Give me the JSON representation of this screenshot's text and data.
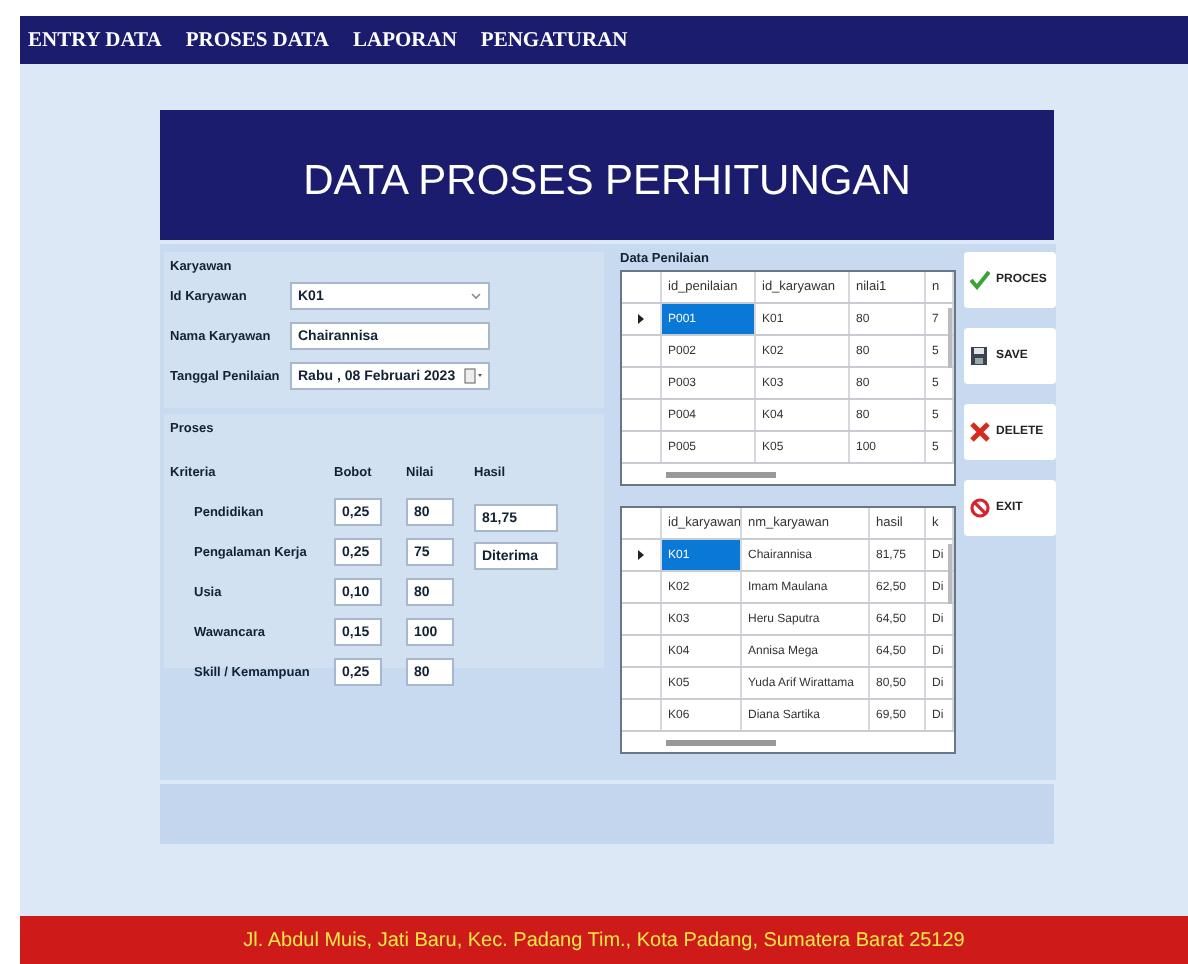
{
  "menu": [
    "ENTRY DATA",
    "PROSES DATA",
    "LAPORAN",
    "PENGATURAN"
  ],
  "title": "DATA PROSES PERHITUNGAN",
  "karyawan": {
    "title": "Karyawan",
    "fields": [
      {
        "kind": "combo",
        "label": "Id Karyawan",
        "value": "K01"
      },
      {
        "kind": "text",
        "label": "Nama Karyawan",
        "value": "Chairannisa"
      },
      {
        "kind": "date",
        "label": "Tanggal Penilaian",
        "value": "Rabu , 08  Februari  2023"
      }
    ]
  },
  "proses": {
    "title": "Proses",
    "headers": [
      "Kriteria",
      "Bobot",
      "Nilai",
      "Hasil"
    ],
    "rows": [
      {
        "kriteria": "Pendidikan",
        "bobot": "0,25",
        "nilai": "80"
      },
      {
        "kriteria": "Pengalaman Kerja",
        "bobot": "0,25",
        "nilai": "75"
      },
      {
        "kriteria": "Usia",
        "bobot": "0,10",
        "nilai": "80"
      },
      {
        "kriteria": "Wawancara",
        "bobot": "0,15",
        "nilai": "100"
      },
      {
        "kriteria": "Skill / Kemampuan",
        "bobot": "0,25",
        "nilai": "80"
      }
    ],
    "hasil": [
      "81,75",
      "Diterima"
    ]
  },
  "grids": [
    {
      "title": "Data Penilaian",
      "columns": [
        "id_penilaian",
        "id_karyawan",
        "nilai1",
        "n"
      ],
      "rows": [
        {
          "selected": true,
          "cells": [
            "P001",
            "K01",
            "80",
            "7"
          ]
        },
        {
          "selected": false,
          "cells": [
            "P002",
            "K02",
            "80",
            "5"
          ]
        },
        {
          "selected": false,
          "cells": [
            "P003",
            "K03",
            "80",
            "5"
          ]
        },
        {
          "selected": false,
          "cells": [
            "P004",
            "K04",
            "80",
            "5"
          ]
        },
        {
          "selected": false,
          "cells": [
            "P005",
            "K05",
            "100",
            "5"
          ]
        }
      ]
    },
    {
      "columns": [
        "id_karyawan",
        "nm_karyawan",
        "hasil",
        "k"
      ],
      "rows": [
        {
          "selected": true,
          "cells": [
            "K01",
            "Chairannisa",
            "81,75",
            "Di"
          ]
        },
        {
          "selected": false,
          "cells": [
            "K02",
            "Imam Maulana",
            "62,50",
            "Di"
          ]
        },
        {
          "selected": false,
          "cells": [
            "K03",
            "Heru Saputra",
            "64,50",
            "Di"
          ]
        },
        {
          "selected": false,
          "cells": [
            "K04",
            "Annisa Mega",
            "64,50",
            "Di"
          ]
        },
        {
          "selected": false,
          "cells": [
            "K05",
            "Yuda Arif Wirattama",
            "80,50",
            "Di"
          ]
        },
        {
          "selected": false,
          "cells": [
            "K06",
            "Diana Sartika",
            "69,50",
            "Di"
          ]
        }
      ]
    }
  ],
  "buttons": [
    {
      "kind": "check",
      "label": "PROCES"
    },
    {
      "kind": "save",
      "label": "SAVE"
    },
    {
      "kind": "cross",
      "label": "DELETE"
    },
    {
      "kind": "forbid",
      "label": "EXIT"
    }
  ],
  "footer": "Jl. Abdul Muis, Jati Baru, Kec. Padang Tim., Kota Padang, Sumatera Barat 25129"
}
